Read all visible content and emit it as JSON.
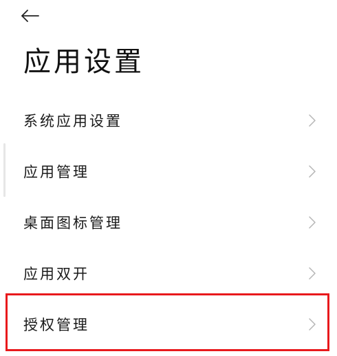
{
  "header": {
    "back_icon": "back-arrow-icon",
    "title": "应用设置"
  },
  "menu": {
    "items": [
      {
        "label": "系统应用设置",
        "icon": "chevron-right-icon"
      },
      {
        "label": "应用管理",
        "icon": "chevron-right-icon"
      },
      {
        "label": "桌面图标管理",
        "icon": "chevron-right-icon"
      },
      {
        "label": "应用双开",
        "icon": "chevron-right-icon"
      },
      {
        "label": "授权管理",
        "icon": "chevron-right-icon"
      }
    ]
  },
  "annotation": {
    "highlight_color": "#e8191c",
    "highlighted_item": "授权管理"
  },
  "colors": {
    "background": "#ffffff",
    "text": "#111111",
    "chevron": "#b5b5b5"
  }
}
